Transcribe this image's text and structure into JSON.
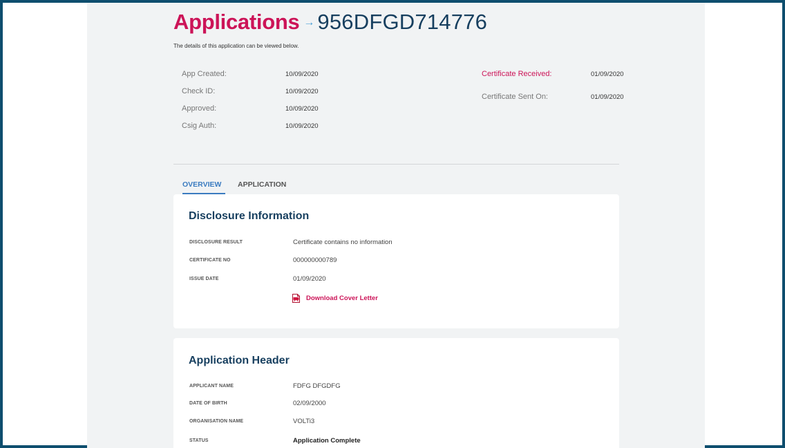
{
  "header": {
    "title": "Applications",
    "arrow": "→",
    "application_id": "956DFGD714776",
    "subtitle": "The details of this application can be viewed below."
  },
  "meta_left": [
    {
      "label": "App Created:",
      "value": "10/09/2020"
    },
    {
      "label": "Check ID:",
      "value": "10/09/2020"
    },
    {
      "label": "Approved:",
      "value": "10/09/2020"
    },
    {
      "label": "Csig Auth:",
      "value": "10/09/2020"
    }
  ],
  "meta_right": [
    {
      "label": "Certificate Received:",
      "value": "01/09/2020"
    },
    {
      "label": "Certificate Sent On:",
      "value": "01/09/2020"
    }
  ],
  "tabs": [
    {
      "label": "OVERVIEW",
      "active": true
    },
    {
      "label": "APPLICATION",
      "active": false
    }
  ],
  "disclosure": {
    "title": "Disclosure Information",
    "fields": [
      {
        "label": "DISCLOSURE RESULT",
        "value": "Certificate contains no information"
      },
      {
        "label": "CERTIFICATE NO",
        "value": "000000000789"
      },
      {
        "label": "ISSUE DATE",
        "value": "01/09/2020"
      }
    ],
    "download_label": "Download Cover Letter",
    "download_icon": "pdf-file-icon"
  },
  "application_header": {
    "title": "Application Header",
    "fields": [
      {
        "label": "APPLICANT NAME",
        "value": "FDFG DFGDFG"
      },
      {
        "label": "DATE OF BIRTH",
        "value": "02/09/2000"
      },
      {
        "label": "ORGANISATION NAME",
        "value": "VOLTi3"
      },
      {
        "label": "STATUS",
        "value": "Application Complete"
      }
    ]
  },
  "colors": {
    "accent": "#cc1458",
    "heading": "#173f5f",
    "tab_active": "#3a7bc0",
    "frame_border": "#0e4e6e",
    "page_bg": "#f1f3f4"
  }
}
